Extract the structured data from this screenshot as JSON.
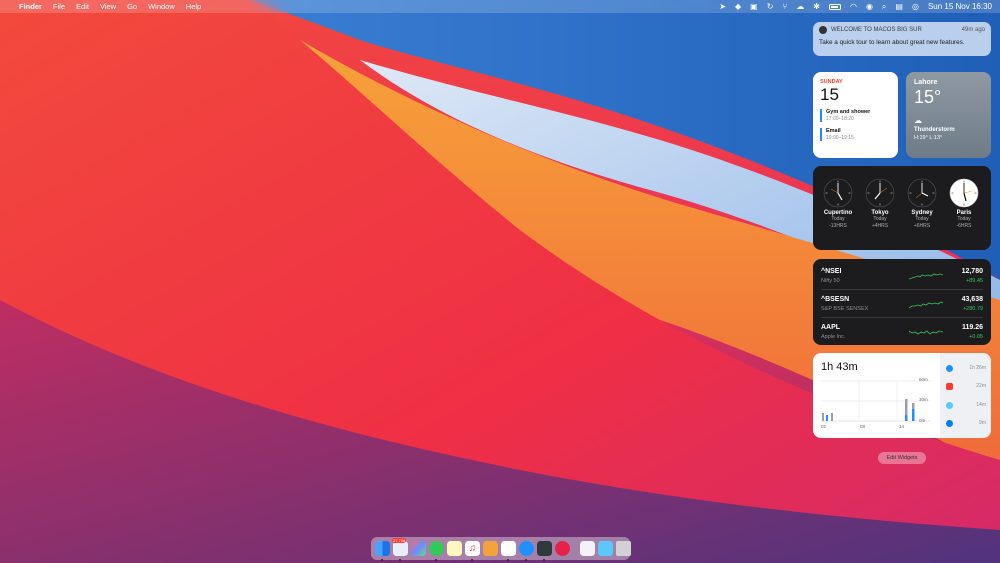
{
  "menubar": {
    "apple": "",
    "items": [
      "Finder",
      "File",
      "Edit",
      "View",
      "Go",
      "Window",
      "Help"
    ],
    "datetime": "Sun 15 Nov  16:30"
  },
  "notification": {
    "app": "WELCOME TO MACOS BIG SUR",
    "time": "49m ago",
    "message": "Take a quick tour to learn about great new features."
  },
  "calendar": {
    "day": "SUNDAY",
    "date": "15",
    "events": [
      {
        "title": "Gym and shower",
        "time": "17:00–18:20"
      },
      {
        "title": "Email",
        "time": "19:00–19:15"
      }
    ]
  },
  "weather": {
    "city": "Lahore",
    "temp": "15°",
    "condition": "Thunderstorm",
    "hilo": "H:19° L:13°"
  },
  "clocks": [
    {
      "city": "Cupertino",
      "day": "Today",
      "offset": "-13HRS",
      "dark": true
    },
    {
      "city": "Tokyo",
      "day": "Today",
      "offset": "+4HRS",
      "dark": true
    },
    {
      "city": "Sydney",
      "day": "Today",
      "offset": "+6HRS",
      "dark": true
    },
    {
      "city": "Paris",
      "day": "Today",
      "offset": "-6HRS",
      "dark": false
    }
  ],
  "stocks": [
    {
      "symbol": "^NSEI",
      "name": "Nifty 50",
      "value": "12,780",
      "change": "+89.45"
    },
    {
      "symbol": "^BSESN",
      "name": "S&P BSE SENSEX",
      "value": "43,638",
      "change": "+280.79"
    },
    {
      "symbol": "AAPL",
      "name": "Apple Inc.",
      "value": "119.26",
      "change": "+0.05"
    }
  ],
  "screentime": {
    "total": "1h 43m",
    "grid_labels": [
      "60m",
      "30m",
      "0m"
    ],
    "x_labels": [
      "02",
      "08",
      "14"
    ],
    "apps": [
      {
        "icon": "safari-icon",
        "color": "#1e90ff",
        "time": "1h 26m"
      },
      {
        "icon": "youtube-icon",
        "color": "#ff3b30",
        "time": "22m"
      },
      {
        "icon": "safari-icon",
        "color": "#5ac8fa",
        "time": "14m"
      },
      {
        "icon": "safari-icon",
        "color": "#007aff",
        "time": "9m"
      }
    ]
  },
  "edit_widgets": "Edit Widgets",
  "dock": {
    "badge": "27,706"
  }
}
